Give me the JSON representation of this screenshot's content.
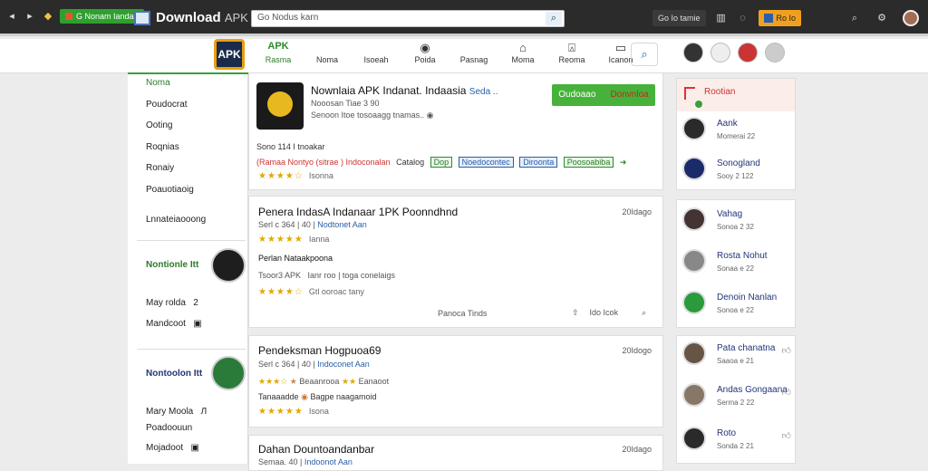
{
  "browser": {
    "brand": "Download",
    "brand_suffix": "APK",
    "search_value": "Go Nodus karn",
    "pill_1": "Go Io tamie",
    "orange_btn": "Ro Io",
    "green_btn": "G Nonam Iandaa"
  },
  "topnav": {
    "logo_text": "APK",
    "items": [
      {
        "icon": "APK",
        "label": "Rasma"
      },
      {
        "icon": "",
        "label": "Noma"
      },
      {
        "icon": "",
        "label": "Isoeah"
      },
      {
        "icon": "◉",
        "label": "Poida"
      },
      {
        "icon": "",
        "label": "Pasnag"
      },
      {
        "icon": "⌂",
        "label": "Moma"
      },
      {
        "icon": "⍓",
        "label": "Reoma"
      },
      {
        "icon": "▭",
        "label": "Icanon"
      }
    ]
  },
  "sidebar": {
    "items": [
      "Noma",
      "Poudocrat",
      "Ooting",
      "Roqnias",
      "Ronaiy",
      "Poauotiaoig",
      "Lnnateiaooong"
    ],
    "feature1": {
      "title": "Nontionle Itt",
      "links": [
        {
          "label": "May rolda",
          "badge": "2"
        },
        {
          "label": "Mandcoot",
          "badge": "▣"
        }
      ]
    },
    "feature2": {
      "title": "Nontoolon Itt",
      "links": [
        {
          "label": "Mary Moola",
          "badge": "Л"
        },
        {
          "label": "Poadoouun",
          "badge": ""
        },
        {
          "label": "Mojadoot",
          "badge": "▣"
        }
      ]
    }
  },
  "main": {
    "hero": {
      "title": "Nownlaia APK Indanat. Indaasia",
      "title_link": "Seda ..",
      "sub1": "Nooosan Tiae 3 90",
      "sub2": "Senoon Itoe tosoaagg tnamas..",
      "download_btn": "Oudoaao",
      "download_btn_2": "Donvnloa",
      "size": "Sono 114 I tnoakar",
      "tag_line": "(Ramaa Nontyo (sitrae ) Indoconalan",
      "catalog_label": "Catalog",
      "tags": [
        {
          "text": "Dop",
          "color": "green"
        },
        {
          "text": "Noedocontec",
          "color": "blue"
        },
        {
          "text": "Diroonta",
          "color": "blue"
        },
        {
          "text": "Poosoabiba",
          "color": "green"
        }
      ],
      "rating_text": "Isonna"
    },
    "cards": [
      {
        "title": "Penera IndasA Indanaar 1PK Poonndhnd",
        "date": "20Idago",
        "meta": "Serl c 364 | 40",
        "meta_link": "Nodtonet Aan",
        "rating": "Ianna",
        "desc": "Perlan Nataakpoona",
        "sub_meta_1": "Tsoor3 APK",
        "sub_meta_2": "Ianr roo | toga conelaigs",
        "rating2": "Gtl ooroac tany",
        "footer_1": "Panoca Tinds",
        "footer_2": "Ido Icok"
      },
      {
        "title": "Pendeksman Hogpuoa69",
        "date": "20Idogo",
        "meta": "Serl c 364 | 40",
        "meta_link": "Indoconet Aan",
        "row2_a": "Beaanrooa",
        "row2_b": "Eanaoot",
        "row3": "Tanaaadde",
        "row3_b": "Bagpe naagamoid",
        "rating": "Isona"
      },
      {
        "title": "Dahan Dountoandanbar",
        "date": "20Idago",
        "meta": "Semaa. 40",
        "meta_link": "Indoonot Aan"
      }
    ]
  },
  "right": {
    "header": "Rootian",
    "group1": [
      {
        "name": "Aank",
        "sub": "Momerai 22"
      },
      {
        "name": "Sonogland",
        "sub": "Sooy 2 122"
      }
    ],
    "group2": [
      {
        "name": "Vahag",
        "sub": "Sonoa 2 32"
      },
      {
        "name": "Rosta Nohut",
        "sub": "Sonaa e 22"
      },
      {
        "name": "Denoin Nanlan",
        "sub": "Sonoa e 22"
      }
    ],
    "group3": [
      {
        "name": "Pata chanatna",
        "sub": "Saaoa e 21"
      },
      {
        "name": "Andas Gongaana",
        "sub": "Serma 2 22"
      },
      {
        "name": "Roto",
        "sub": "Sonda 2 21"
      }
    ]
  }
}
